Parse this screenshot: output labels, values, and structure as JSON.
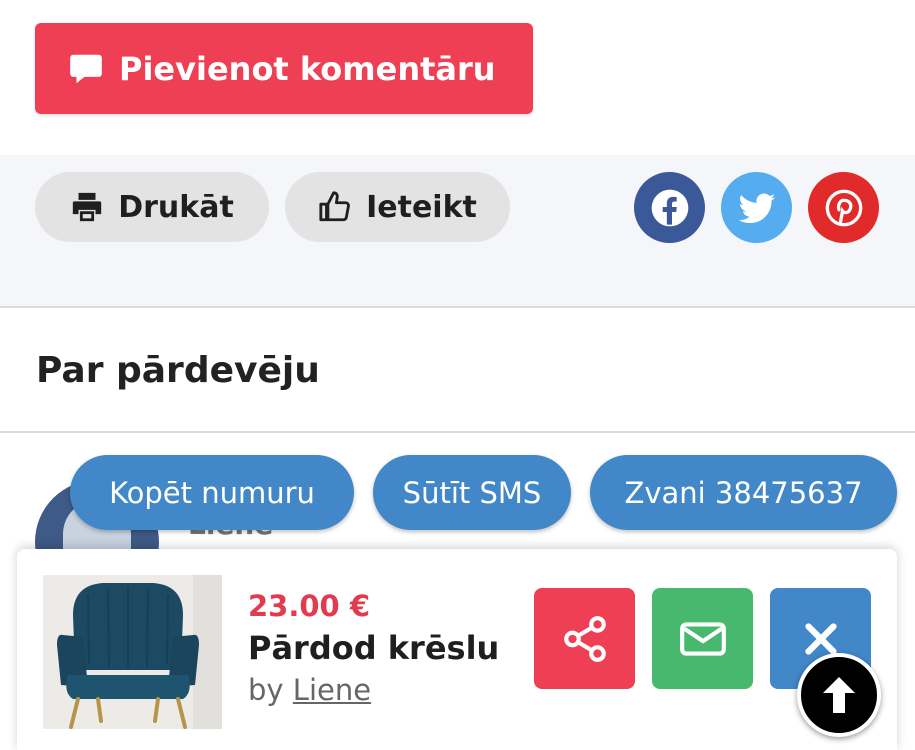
{
  "comment": {
    "add_label": "Pievienot komentāru",
    "icon": "comment-icon"
  },
  "actions": {
    "print_label": "Drukāt",
    "recommend_label": "Ieteikt",
    "social": [
      "facebook-icon",
      "twitter-icon",
      "pinterest-icon"
    ]
  },
  "seller": {
    "section_title": "Par pārdevēju",
    "name_partial": "Liene"
  },
  "contact": {
    "copy_label": "Kopēt numuru",
    "sms_label": "Sūtīt SMS",
    "call_label": "Zvani 38475637"
  },
  "listing": {
    "price": "23.00 €",
    "title": "Pārdod krēslu",
    "by_prefix": "by",
    "seller_name": "Liene"
  },
  "colors": {
    "primary_red": "#ee3f55",
    "primary_blue": "#4287c7",
    "green": "#47b96f",
    "facebook": "#3b5998",
    "twitter": "#55acee",
    "pinterest": "#e12b2b"
  }
}
